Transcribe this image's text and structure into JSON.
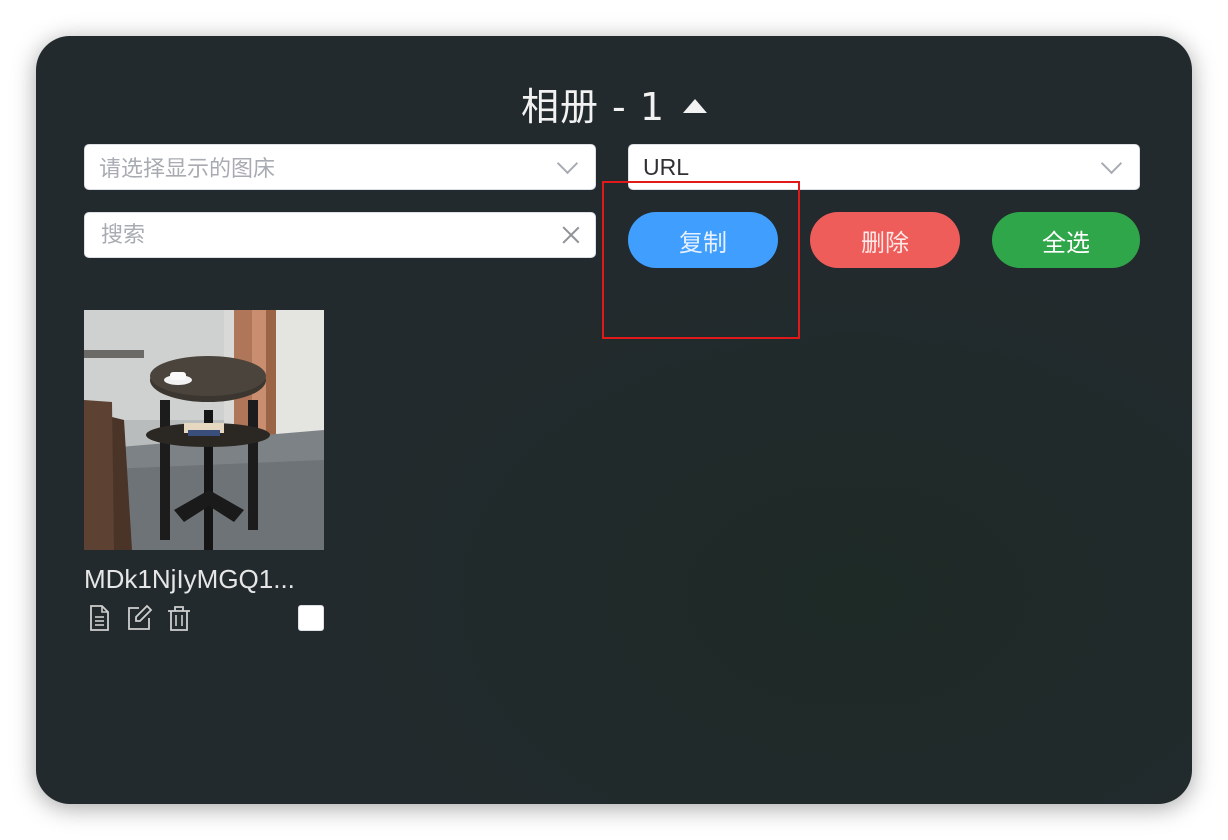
{
  "header": {
    "title": "相册 - 1"
  },
  "filters": {
    "host_select_placeholder": "请选择显示的图床",
    "format_select_value": "URL",
    "search_placeholder": "搜索"
  },
  "buttons": {
    "copy": "复制",
    "delete": "删除",
    "select_all": "全选"
  },
  "colors": {
    "copy": "#409eff",
    "delete": "#ee5d5a",
    "select_all": "#30a64a",
    "background": "#222a2d"
  },
  "gallery": [
    {
      "filename": "MDk1NjIyMGQ1...",
      "thumbnail_icon": "side-table-photo",
      "action_icons": [
        "document-icon",
        "edit-icon",
        "trash-icon"
      ],
      "checked": false
    }
  ]
}
